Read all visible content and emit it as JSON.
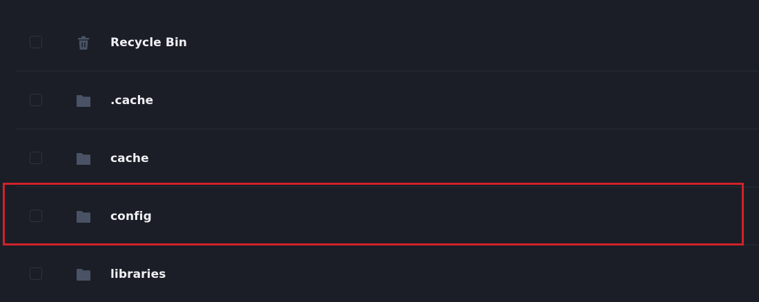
{
  "items": [
    {
      "label": "Recycle Bin",
      "icon": "trash-icon"
    },
    {
      "label": ".cache",
      "icon": "folder-icon"
    },
    {
      "label": "cache",
      "icon": "folder-icon"
    },
    {
      "label": "config",
      "icon": "folder-icon"
    },
    {
      "label": "libraries",
      "icon": "folder-icon"
    }
  ],
  "colors": {
    "background": "#1b1e26",
    "icon": "#4a5366",
    "text": "#eef0f4",
    "highlight_border": "#d1222a"
  }
}
